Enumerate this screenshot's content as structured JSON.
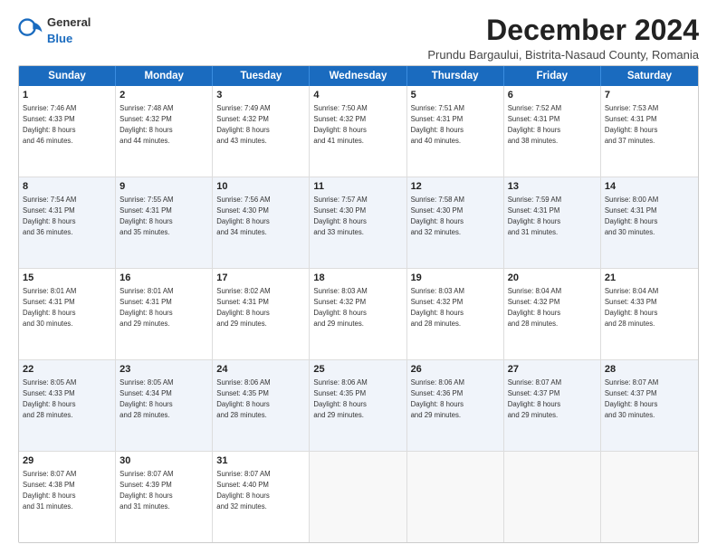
{
  "logo": {
    "general": "General",
    "blue": "Blue"
  },
  "title": "December 2024",
  "subtitle": "Prundu Bargaului, Bistrita-Nasaud County, Romania",
  "header_days": [
    "Sunday",
    "Monday",
    "Tuesday",
    "Wednesday",
    "Thursday",
    "Friday",
    "Saturday"
  ],
  "rows": [
    {
      "alt": false,
      "cells": [
        {
          "day": "1",
          "text": "Sunrise: 7:46 AM\nSunset: 4:33 PM\nDaylight: 8 hours\nand 46 minutes."
        },
        {
          "day": "2",
          "text": "Sunrise: 7:48 AM\nSunset: 4:32 PM\nDaylight: 8 hours\nand 44 minutes."
        },
        {
          "day": "3",
          "text": "Sunrise: 7:49 AM\nSunset: 4:32 PM\nDaylight: 8 hours\nand 43 minutes."
        },
        {
          "day": "4",
          "text": "Sunrise: 7:50 AM\nSunset: 4:32 PM\nDaylight: 8 hours\nand 41 minutes."
        },
        {
          "day": "5",
          "text": "Sunrise: 7:51 AM\nSunset: 4:31 PM\nDaylight: 8 hours\nand 40 minutes."
        },
        {
          "day": "6",
          "text": "Sunrise: 7:52 AM\nSunset: 4:31 PM\nDaylight: 8 hours\nand 38 minutes."
        },
        {
          "day": "7",
          "text": "Sunrise: 7:53 AM\nSunset: 4:31 PM\nDaylight: 8 hours\nand 37 minutes."
        }
      ]
    },
    {
      "alt": true,
      "cells": [
        {
          "day": "8",
          "text": "Sunrise: 7:54 AM\nSunset: 4:31 PM\nDaylight: 8 hours\nand 36 minutes."
        },
        {
          "day": "9",
          "text": "Sunrise: 7:55 AM\nSunset: 4:31 PM\nDaylight: 8 hours\nand 35 minutes."
        },
        {
          "day": "10",
          "text": "Sunrise: 7:56 AM\nSunset: 4:30 PM\nDaylight: 8 hours\nand 34 minutes."
        },
        {
          "day": "11",
          "text": "Sunrise: 7:57 AM\nSunset: 4:30 PM\nDaylight: 8 hours\nand 33 minutes."
        },
        {
          "day": "12",
          "text": "Sunrise: 7:58 AM\nSunset: 4:30 PM\nDaylight: 8 hours\nand 32 minutes."
        },
        {
          "day": "13",
          "text": "Sunrise: 7:59 AM\nSunset: 4:31 PM\nDaylight: 8 hours\nand 31 minutes."
        },
        {
          "day": "14",
          "text": "Sunrise: 8:00 AM\nSunset: 4:31 PM\nDaylight: 8 hours\nand 30 minutes."
        }
      ]
    },
    {
      "alt": false,
      "cells": [
        {
          "day": "15",
          "text": "Sunrise: 8:01 AM\nSunset: 4:31 PM\nDaylight: 8 hours\nand 30 minutes."
        },
        {
          "day": "16",
          "text": "Sunrise: 8:01 AM\nSunset: 4:31 PM\nDaylight: 8 hours\nand 29 minutes."
        },
        {
          "day": "17",
          "text": "Sunrise: 8:02 AM\nSunset: 4:31 PM\nDaylight: 8 hours\nand 29 minutes."
        },
        {
          "day": "18",
          "text": "Sunrise: 8:03 AM\nSunset: 4:32 PM\nDaylight: 8 hours\nand 29 minutes."
        },
        {
          "day": "19",
          "text": "Sunrise: 8:03 AM\nSunset: 4:32 PM\nDaylight: 8 hours\nand 28 minutes."
        },
        {
          "day": "20",
          "text": "Sunrise: 8:04 AM\nSunset: 4:32 PM\nDaylight: 8 hours\nand 28 minutes."
        },
        {
          "day": "21",
          "text": "Sunrise: 8:04 AM\nSunset: 4:33 PM\nDaylight: 8 hours\nand 28 minutes."
        }
      ]
    },
    {
      "alt": true,
      "cells": [
        {
          "day": "22",
          "text": "Sunrise: 8:05 AM\nSunset: 4:33 PM\nDaylight: 8 hours\nand 28 minutes."
        },
        {
          "day": "23",
          "text": "Sunrise: 8:05 AM\nSunset: 4:34 PM\nDaylight: 8 hours\nand 28 minutes."
        },
        {
          "day": "24",
          "text": "Sunrise: 8:06 AM\nSunset: 4:35 PM\nDaylight: 8 hours\nand 28 minutes."
        },
        {
          "day": "25",
          "text": "Sunrise: 8:06 AM\nSunset: 4:35 PM\nDaylight: 8 hours\nand 29 minutes."
        },
        {
          "day": "26",
          "text": "Sunrise: 8:06 AM\nSunset: 4:36 PM\nDaylight: 8 hours\nand 29 minutes."
        },
        {
          "day": "27",
          "text": "Sunrise: 8:07 AM\nSunset: 4:37 PM\nDaylight: 8 hours\nand 29 minutes."
        },
        {
          "day": "28",
          "text": "Sunrise: 8:07 AM\nSunset: 4:37 PM\nDaylight: 8 hours\nand 30 minutes."
        }
      ]
    },
    {
      "alt": false,
      "cells": [
        {
          "day": "29",
          "text": "Sunrise: 8:07 AM\nSunset: 4:38 PM\nDaylight: 8 hours\nand 31 minutes."
        },
        {
          "day": "30",
          "text": "Sunrise: 8:07 AM\nSunset: 4:39 PM\nDaylight: 8 hours\nand 31 minutes."
        },
        {
          "day": "31",
          "text": "Sunrise: 8:07 AM\nSunset: 4:40 PM\nDaylight: 8 hours\nand 32 minutes."
        },
        {
          "day": "",
          "text": ""
        },
        {
          "day": "",
          "text": ""
        },
        {
          "day": "",
          "text": ""
        },
        {
          "day": "",
          "text": ""
        }
      ]
    }
  ]
}
